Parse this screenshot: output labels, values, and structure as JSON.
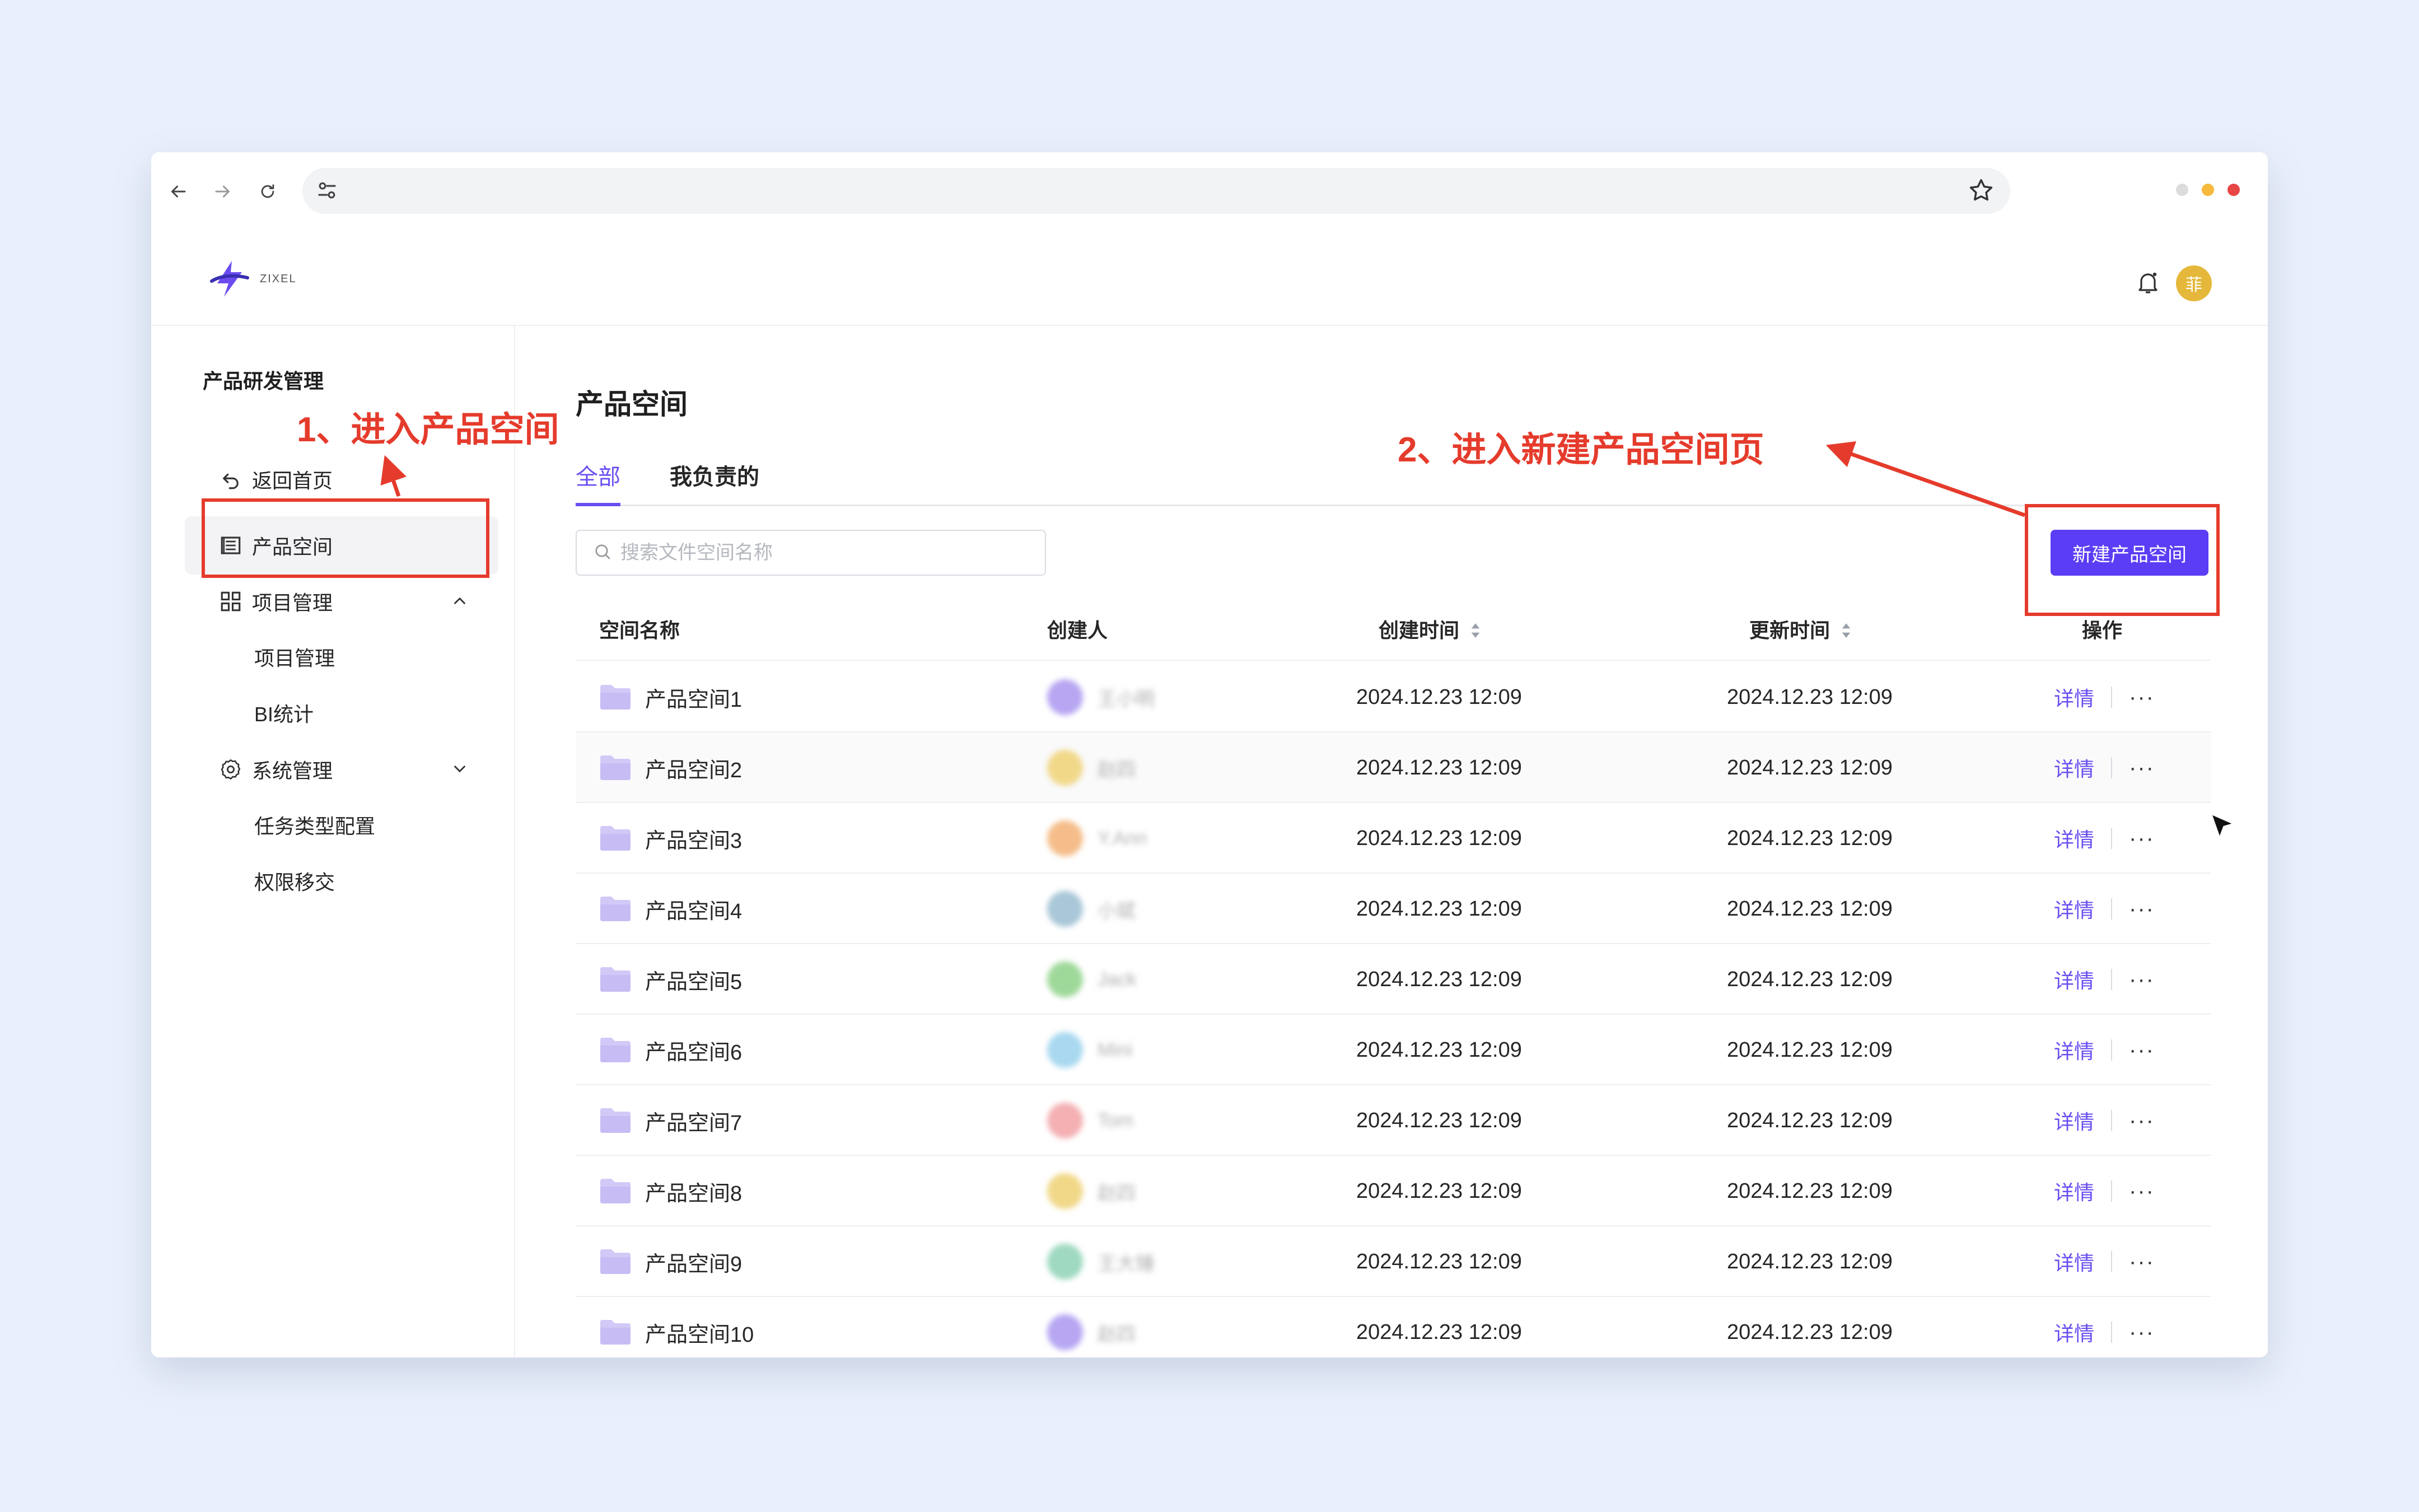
{
  "browser": {
    "back_icon": "arrow-left-icon",
    "forward_icon": "arrow-right-icon",
    "reload_icon": "reload-icon",
    "site_settings_icon": "tune-icon",
    "bookmark_icon": "star-icon",
    "address": "",
    "window_dots": [
      "#dcdcdc",
      "#f6b93b",
      "#e84545"
    ]
  },
  "app": {
    "logo_text": "ZIXEL",
    "avatar_text": "菲",
    "bell_icon": "bell-icon"
  },
  "sidebar": {
    "title": "产品研发管理",
    "back_label": "返回首页",
    "items": [
      {
        "label": "产品空间",
        "icon": "list-icon",
        "active": true
      },
      {
        "label": "项目管理",
        "icon": "grid-icon",
        "expanded": true
      },
      {
        "label": "系统管理",
        "icon": "gear-icon",
        "expanded": false
      }
    ],
    "project_children": [
      "项目管理",
      "BI统计"
    ],
    "system_children": [
      "任务类型配置",
      "权限移交"
    ]
  },
  "main": {
    "title": "产品空间",
    "tabs": [
      {
        "label": "全部",
        "active": true
      },
      {
        "label": "我负责的",
        "active": false
      }
    ],
    "search_placeholder": "搜索文件空间名称",
    "new_button": "新建产品空间",
    "columns": {
      "name": "空间名称",
      "creator": "创建人",
      "created": "创建时间",
      "updated": "更新时间",
      "actions": "操作"
    },
    "detail_label": "详情",
    "more_label": "···",
    "rows": [
      {
        "name": "产品空间1",
        "creator": "王小明",
        "avatar_color": "#b7a6f2",
        "created": "2024.12.23 12:09",
        "updated": "2024.12.23 12:09"
      },
      {
        "name": "产品空间2",
        "creator": "赵四",
        "avatar_color": "#f1d889",
        "created": "2024.12.23 12:09",
        "updated": "2024.12.23 12:09"
      },
      {
        "name": "产品空间3",
        "creator": "Y.Ann",
        "avatar_color": "#f5bd8a",
        "created": "2024.12.23 12:09",
        "updated": "2024.12.23 12:09"
      },
      {
        "name": "产品空间4",
        "creator": "小斌",
        "avatar_color": "#a9c7d8",
        "created": "2024.12.23 12:09",
        "updated": "2024.12.23 12:09"
      },
      {
        "name": "产品空间5",
        "creator": "Jack",
        "avatar_color": "#9fd99a",
        "created": "2024.12.23 12:09",
        "updated": "2024.12.23 12:09"
      },
      {
        "name": "产品空间6",
        "creator": "Mini",
        "avatar_color": "#a9d8f0",
        "created": "2024.12.23 12:09",
        "updated": "2024.12.23 12:09"
      },
      {
        "name": "产品空间7",
        "creator": "Tom",
        "avatar_color": "#f4b0b3",
        "created": "2024.12.23 12:09",
        "updated": "2024.12.23 12:09"
      },
      {
        "name": "产品空间8",
        "creator": "赵四",
        "avatar_color": "#f1d889",
        "created": "2024.12.23 12:09",
        "updated": "2024.12.23 12:09"
      },
      {
        "name": "产品空间9",
        "creator": "王大锤",
        "avatar_color": "#9ed9c0",
        "created": "2024.12.23 12:09",
        "updated": "2024.12.23 12:09"
      },
      {
        "name": "产品空间10",
        "creator": "赵四",
        "avatar_color": "#b7a6f2",
        "created": "2024.12.23 12:09",
        "updated": "2024.12.23 12:09"
      }
    ]
  },
  "annotations": {
    "step1": "1、进入产品空间",
    "step2": "2、进入新建产品空间页",
    "color": "#e53b2c"
  },
  "colors": {
    "accent": "#5b3df5",
    "link": "#6b4ef2",
    "folder": "#d3c9f7"
  }
}
